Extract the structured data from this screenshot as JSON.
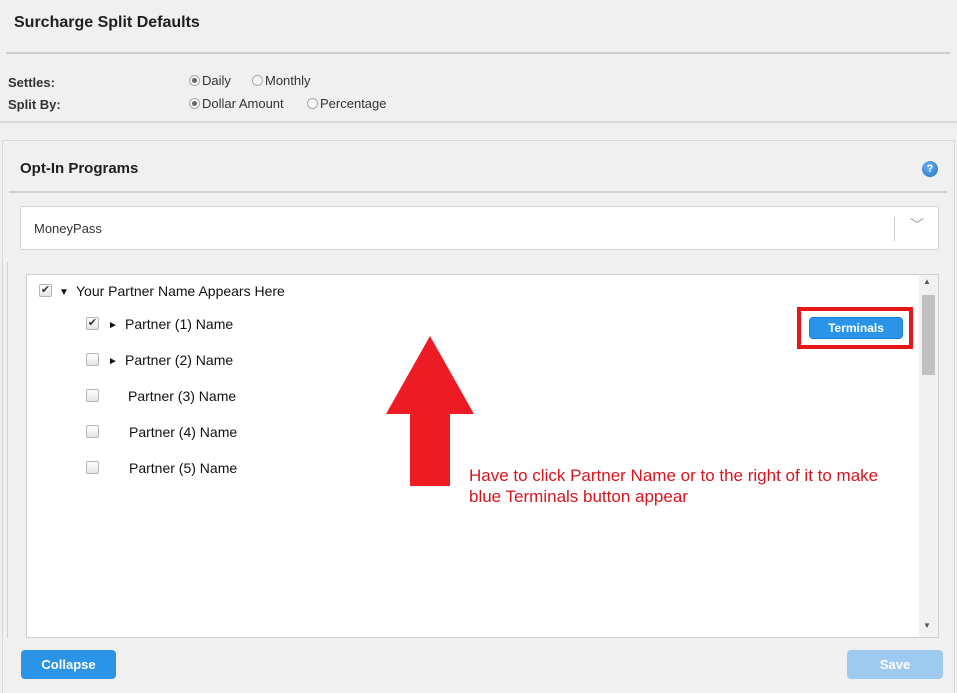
{
  "surcharge": {
    "title": "Surcharge Split Defaults",
    "settles": {
      "label": "Settles:",
      "options": [
        {
          "label": "Daily",
          "checked": true
        },
        {
          "label": "Monthly",
          "checked": false
        }
      ]
    },
    "split_by": {
      "label": "Split By:",
      "options": [
        {
          "label": "Dollar Amount",
          "checked": true
        },
        {
          "label": "Percentage",
          "checked": false
        }
      ]
    }
  },
  "opt_in": {
    "title": "Opt-In Programs",
    "help_icon": "?",
    "program_select": {
      "value": "MoneyPass"
    },
    "tree": {
      "root": {
        "label": "Your Partner Name Appears Here",
        "checked": true,
        "expanded": true
      },
      "children": [
        {
          "label": "Partner (1) Name",
          "checked": true,
          "has_children": true
        },
        {
          "label": "Partner (2) Name",
          "checked": false,
          "has_children": true
        },
        {
          "label": "Partner (3) Name",
          "checked": false,
          "has_children": false
        },
        {
          "label": "Partner (4) Name",
          "checked": false,
          "has_children": false
        },
        {
          "label": "Partner (5) Name",
          "checked": false,
          "has_children": false
        }
      ]
    },
    "terminals_button": "Terminals"
  },
  "annotation": {
    "text": "Have to click Partner Name or to the right of it to make blue Terminals button appear",
    "color": "#d8141e"
  },
  "footer": {
    "collapse_label": "Collapse",
    "save_label": "Save"
  },
  "colors": {
    "accent": "#2b94e6",
    "save_disabled": "#9fcaf0",
    "highlight": "#e8151b"
  },
  "icons": {
    "expanded": "▼",
    "collapsed": "►",
    "check": "✔",
    "chevron": "﹀"
  }
}
